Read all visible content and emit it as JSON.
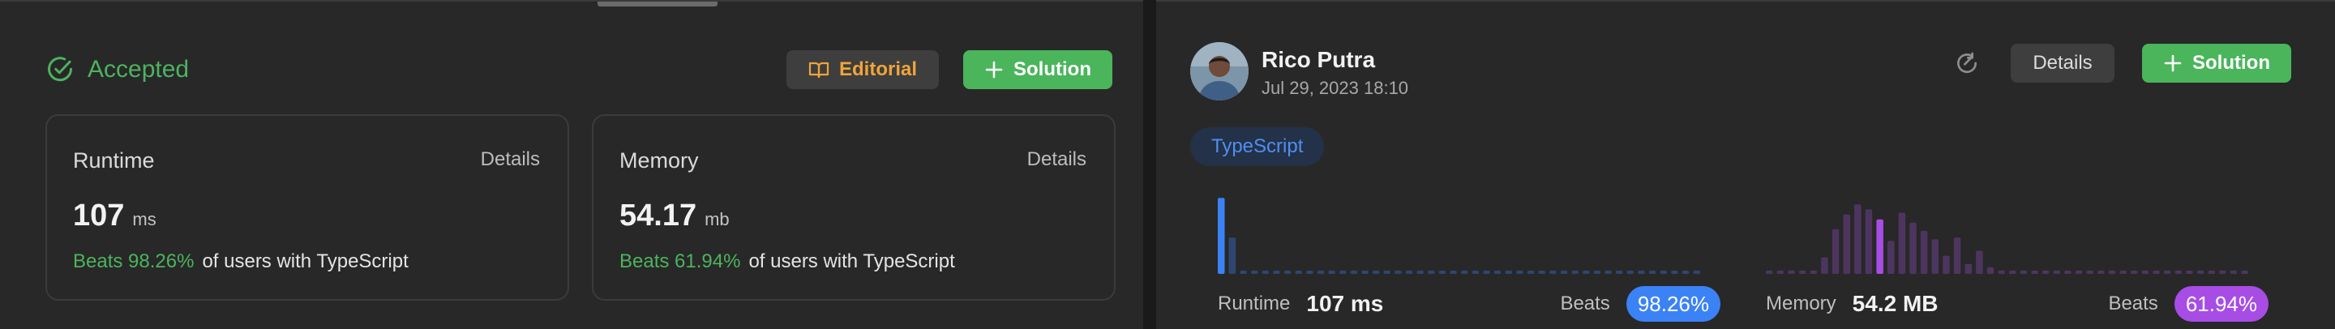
{
  "submission": {
    "status": "Accepted",
    "editorial_label": "Editorial",
    "solution_label": "Solution",
    "runtime_card": {
      "title": "Runtime",
      "details_label": "Details",
      "value": "107",
      "unit": "ms",
      "beats_text": "Beats 98.26%",
      "beats_suffix": "of users with TypeScript"
    },
    "memory_card": {
      "title": "Memory",
      "details_label": "Details",
      "value": "54.17",
      "unit": "mb",
      "beats_text": "Beats 61.94%",
      "beats_suffix": "of users with TypeScript"
    }
  },
  "solution_panel": {
    "user_name": "Rico Putra",
    "date": "Jul 29, 2023 18:10",
    "details_label": "Details",
    "solution_label": "Solution",
    "language": "TypeScript",
    "runtime": {
      "label": "Runtime",
      "value": "107 ms",
      "beats_label": "Beats",
      "beats_pct": "98.26%"
    },
    "memory": {
      "label": "Memory",
      "value": "54.2 MB",
      "beats_label": "Beats",
      "beats_pct": "61.94%"
    }
  },
  "colors": {
    "accepted": "#4cb35e",
    "editorial": "#f0a43a",
    "runtime_accent": "#3b82f6",
    "memory_accent": "#a84ce6"
  },
  "chart_data": [
    {
      "type": "bar",
      "name": "runtime-distribution",
      "values": [
        92,
        44,
        4,
        4,
        4,
        4,
        4,
        4,
        4,
        4,
        4,
        4,
        4,
        4,
        4,
        4,
        4,
        4,
        4,
        4,
        4,
        4,
        4,
        4,
        4,
        4,
        4,
        4,
        4,
        4,
        4,
        4,
        4,
        4,
        4,
        4,
        4,
        4,
        4,
        4,
        4,
        4,
        4,
        4
      ],
      "highlight_index": 0,
      "ylim": [
        0,
        100
      ]
    },
    {
      "type": "bar",
      "name": "memory-distribution",
      "values": [
        4,
        4,
        4,
        4,
        4,
        20,
        54,
        72,
        84,
        78,
        66,
        40,
        74,
        62,
        52,
        42,
        22,
        44,
        12,
        28,
        8,
        4,
        4,
        4,
        4,
        4,
        4,
        4,
        4,
        4,
        4,
        4,
        4,
        4,
        4,
        4,
        4,
        4,
        4,
        4,
        4,
        4,
        4,
        4
      ],
      "highlight_index": 10,
      "ylim": [
        0,
        100
      ]
    }
  ]
}
